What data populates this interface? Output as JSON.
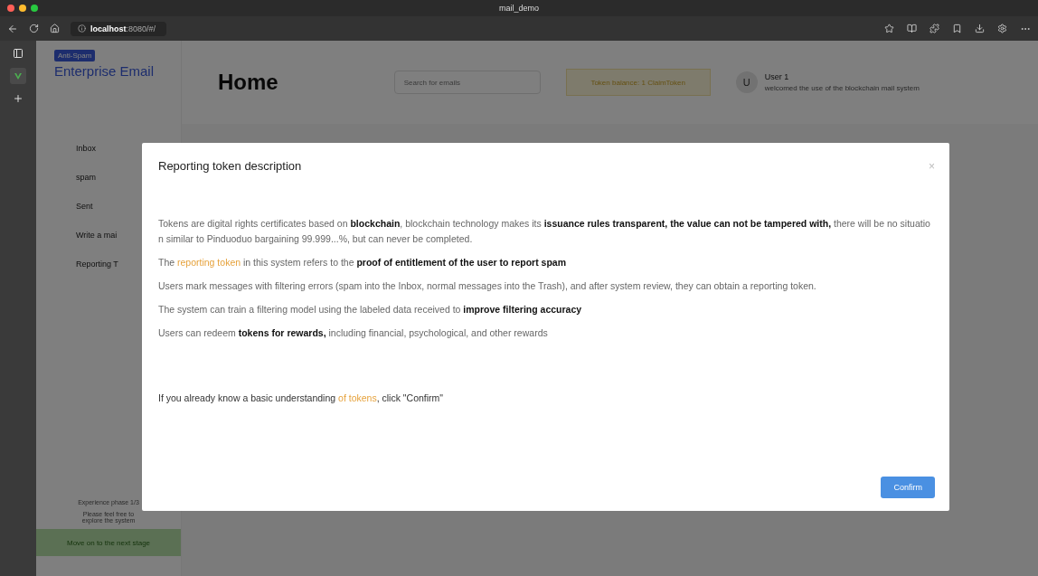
{
  "window": {
    "title": "mail_demo"
  },
  "browser": {
    "url_host": "localhost",
    "url_path": ":8080/#/"
  },
  "app": {
    "badge": "Anti-Spam",
    "brand": "Enterprise Email",
    "page_title": "Home",
    "search": {
      "placeholder": "Search for emails"
    },
    "token_button": "Token balance: 1 ClaimToken",
    "user": {
      "avatar": "U",
      "name": "User 1",
      "greeting": "welcomed the use of the blockchain mail system"
    }
  },
  "sidebar": {
    "items": [
      {
        "label": "Inbox",
        "selected": false
      },
      {
        "label": "spam",
        "selected": false
      },
      {
        "label": "Sent",
        "selected": false
      },
      {
        "label": "Write a mai",
        "selected": false
      },
      {
        "label": "Reporting T",
        "selected": false
      }
    ],
    "phase": "Experience phase 1/3",
    "hint": "Please feel free to explore the system",
    "next_stage": "Move on to the next stage"
  },
  "dialog": {
    "title": "Reporting token description",
    "close": "×",
    "paragraphs": [
      [
        {
          "kind": "plain",
          "text": "Tokens are digital rights certificates based on "
        },
        {
          "kind": "bold",
          "text": "blockchain"
        },
        {
          "kind": "plain",
          "text": ", blockchain technology makes its "
        },
        {
          "kind": "bold",
          "text": "issuance rules transparent, the value can not be tampered with,"
        },
        {
          "kind": "plain",
          "text": " there will be no situation similar to Pinduoduo bargaining 99.999...%, but can never be completed."
        }
      ],
      [
        {
          "kind": "plain",
          "text": "The "
        },
        {
          "kind": "highlight",
          "text": "reporting token"
        },
        {
          "kind": "plain",
          "text": " in this system refers to the "
        },
        {
          "kind": "bold",
          "text": "proof of entitlement of the user to report spam"
        }
      ],
      [
        {
          "kind": "plain",
          "text": "Users mark messages with filtering errors (spam into the Inbox, normal messages into the Trash), and after system review, they can obtain a reporting token."
        }
      ],
      [
        {
          "kind": "plain",
          "text": "The system can train a filtering model using the labeled data received to "
        },
        {
          "kind": "bold",
          "text": "improve filtering accuracy"
        }
      ],
      [
        {
          "kind": "plain",
          "text": "Users can redeem "
        },
        {
          "kind": "bold",
          "text": "tokens for rewards,"
        },
        {
          "kind": "plain",
          "text": " including financial, psychological, and other rewards"
        }
      ]
    ],
    "footer_note": [
      {
        "kind": "plain",
        "text": "If you already know a basic understanding "
      },
      {
        "kind": "highlight",
        "text": "of tokens"
      },
      {
        "kind": "plain",
        "text": ", click \"Confirm\""
      }
    ],
    "confirm": "Confirm"
  }
}
